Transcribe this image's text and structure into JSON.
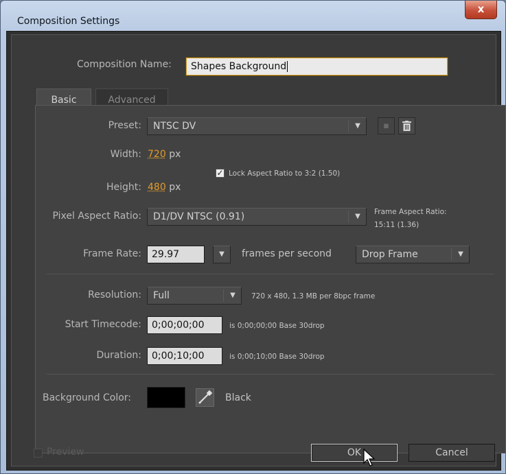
{
  "window": {
    "title": "Composition Settings",
    "close_glyph": "x"
  },
  "composition_name": {
    "label": "Composition Name:",
    "value": "Shapes Background"
  },
  "tabs": [
    {
      "label": "Basic",
      "active": true
    },
    {
      "label": "Advanced",
      "active": false
    }
  ],
  "preset": {
    "label": "Preset:",
    "value": "NTSC DV",
    "icons": [
      "save-preset-icon",
      "trash-icon"
    ]
  },
  "width": {
    "label": "Width:",
    "value": "720",
    "unit": "px"
  },
  "height": {
    "label": "Height:",
    "value": "480",
    "unit": "px"
  },
  "lock_aspect": {
    "label": "Lock Aspect Ratio to 3:2 (1.50)",
    "checked": true
  },
  "pixel_aspect": {
    "label": "Pixel Aspect Ratio:",
    "value": "D1/DV NTSC (0.91)",
    "frame_aspect_label": "Frame Aspect Ratio:",
    "frame_aspect_value": "15:11 (1.36)"
  },
  "frame_rate": {
    "label": "Frame Rate:",
    "value": "29.97",
    "unit": "frames per second",
    "drop_frame": "Drop Frame"
  },
  "resolution": {
    "label": "Resolution:",
    "value": "Full",
    "info": "720 x 480, 1.3 MB per 8bpc frame"
  },
  "start_timecode": {
    "label": "Start Timecode:",
    "value": "0;00;00;00",
    "info": "is 0;00;00;00  Base 30drop"
  },
  "duration": {
    "label": "Duration:",
    "value": "0;00;10;00",
    "info": "is 0;00;10;00  Base 30drop"
  },
  "background_color": {
    "label": "Background Color:",
    "color": "#000000",
    "name": "Black"
  },
  "preview": {
    "label": "Preview",
    "checked": false
  },
  "buttons": {
    "ok": "OK",
    "cancel": "Cancel"
  },
  "colors": {
    "accent_orange": "#e39c2b",
    "dialog_bg": "#3a3a3a"
  }
}
